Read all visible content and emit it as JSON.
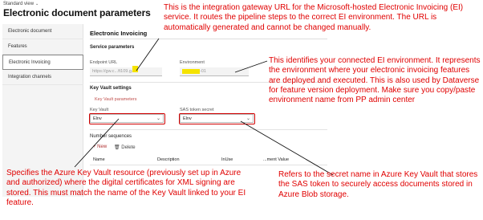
{
  "header": {
    "standard_view": "Standard view",
    "standard_view_chevron": "⌄",
    "title": "Electronic document parameters"
  },
  "sidebar": {
    "items": [
      {
        "label": "Electronic document"
      },
      {
        "label": "Features"
      },
      {
        "label": "Electronic Invoicing"
      },
      {
        "label": "Integration channels"
      }
    ]
  },
  "main": {
    "section_title": "Electronic Invoicing",
    "service_parameters": "Service parameters",
    "endpoint_url_label": "Endpoint URL",
    "endpoint_url_value": "https://gw.c...ft109.g...",
    "environment_label": "Environment",
    "environment_value": "-01",
    "key_vault_settings": "Key Vault settings",
    "key_vault_parameters_link": "Key Vault parameters",
    "key_vault_label": "Key Vault",
    "key_vault_value": "Elnv",
    "sas_label": "SAS token secret",
    "sas_value": "Elnv",
    "number_sequences": "Number sequences",
    "new_button": "+ New",
    "delete_button": "🗑 Delete",
    "columns": [
      "Name",
      "Description",
      "InUse",
      "...ment Value"
    ]
  },
  "annotations": {
    "endpoint_note": "This is the integration gateway URL for the Microsoft-hosted Electronic Invoicing (EI) service. It routes the pipeline steps to the correct EI environment. The URL is automatically generated and cannot be changed manually.",
    "environment_note": "This identifies your connected EI environment. It represents the environment where your electronic invoicing features are deployed and executed. This is also used by Dataverse for feature version deployment. Make sure you copy/paste environment name from PP admin center",
    "keyvault_note": "Specifies the Azure Key Vault resource (previously set up in Azure and authorized) where the digital certificates for XML signing are stored. This must match the name of the Key Vault linked to your EI feature.",
    "sas_note": "Refers to the secret name in Azure Key Vault that stores the SAS token to securely access documents stored in Azure Blob storage."
  },
  "colors": {
    "annotation_red": "#e00000",
    "highlight_yellow": "#f5e300",
    "link_red": "#c0504d"
  }
}
